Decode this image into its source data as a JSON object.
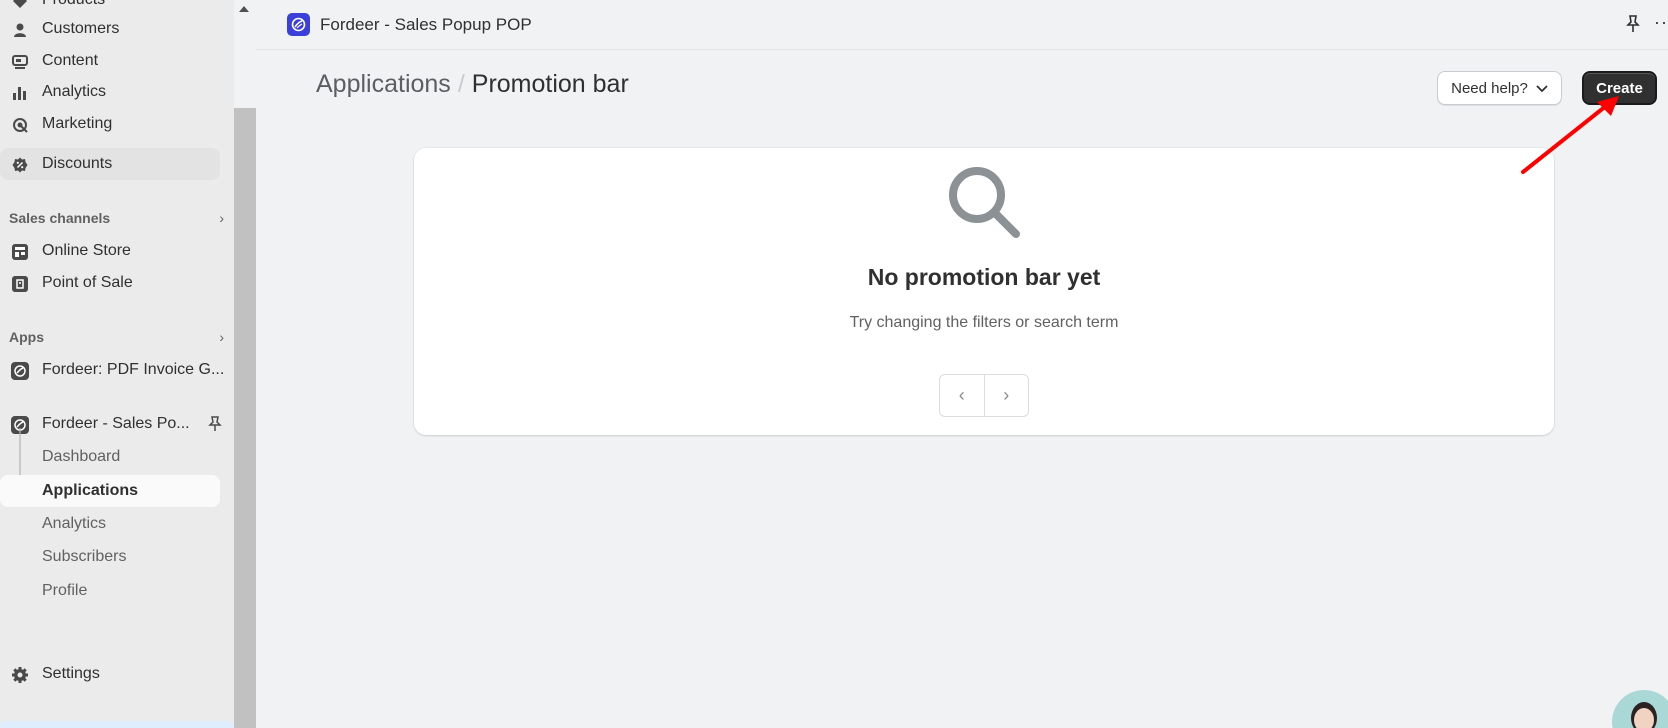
{
  "sidebar": {
    "top_items": [
      {
        "label": "Products",
        "icon": "tag-icon"
      },
      {
        "label": "Customers",
        "icon": "person-icon"
      },
      {
        "label": "Content",
        "icon": "content-icon"
      },
      {
        "label": "Analytics",
        "icon": "bar-chart-icon"
      },
      {
        "label": "Marketing",
        "icon": "target-icon"
      },
      {
        "label": "Discounts",
        "icon": "discount-icon"
      }
    ],
    "sales_channels": {
      "heading": "Sales channels",
      "items": [
        {
          "label": "Online Store",
          "icon": "store-icon"
        },
        {
          "label": "Point of Sale",
          "icon": "pos-icon"
        }
      ]
    },
    "apps": {
      "heading": "Apps",
      "items": [
        {
          "label": "Fordeer: PDF Invoice G...",
          "icon": "fordeer-app-icon"
        },
        {
          "label": "Fordeer - Sales Po...",
          "icon": "fordeer-app-icon"
        }
      ],
      "sub_items": [
        {
          "label": "Dashboard"
        },
        {
          "label": "Applications"
        },
        {
          "label": "Analytics"
        },
        {
          "label": "Subscribers"
        },
        {
          "label": "Profile"
        }
      ]
    },
    "settings": {
      "label": "Settings",
      "icon": "gear-icon"
    }
  },
  "appbar": {
    "title": "Fordeer - Sales Popup POP",
    "more": "··"
  },
  "page": {
    "breadcrumb_parent": "Applications",
    "breadcrumb_separator": "/",
    "title": "Promotion bar",
    "help_label": "Need help?",
    "create_label": "Create"
  },
  "empty_state": {
    "title": "No promotion bar yet",
    "subtitle": "Try changing the filters or search term",
    "prev": "‹",
    "next": "›"
  },
  "colors": {
    "annotation_arrow": "#ff0000",
    "primary_button": "#303030",
    "app_logo": "#3a3fd9"
  }
}
